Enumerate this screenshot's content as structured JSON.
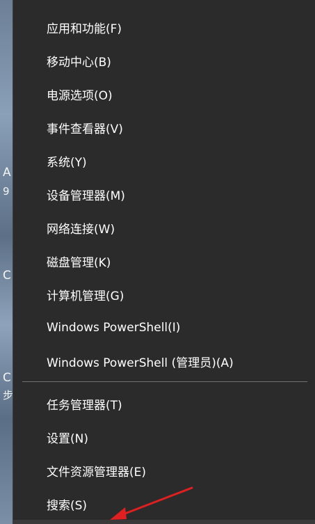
{
  "desktop": {
    "glyphs": [
      "A",
      "9",
      "C",
      "C",
      "步"
    ]
  },
  "menu": {
    "items": [
      {
        "label": "应用和功能(F)"
      },
      {
        "label": "移动中心(B)"
      },
      {
        "label": "电源选项(O)"
      },
      {
        "label": "事件查看器(V)"
      },
      {
        "label": "系统(Y)"
      },
      {
        "label": "设备管理器(M)"
      },
      {
        "label": "网络连接(W)"
      },
      {
        "label": "磁盘管理(K)"
      },
      {
        "label": "计算机管理(G)"
      },
      {
        "label": "Windows PowerShell(I)"
      },
      {
        "label": "Windows PowerShell (管理员)(A)"
      },
      {
        "label": "任务管理器(T)"
      },
      {
        "label": "设置(N)"
      },
      {
        "label": "文件资源管理器(E)"
      },
      {
        "label": "搜索(S)"
      }
    ]
  },
  "colors": {
    "menu_background": "#2b2b2b",
    "menu_text": "#ffffff",
    "separator": "#707070",
    "annotation_arrow": "#e02020"
  }
}
